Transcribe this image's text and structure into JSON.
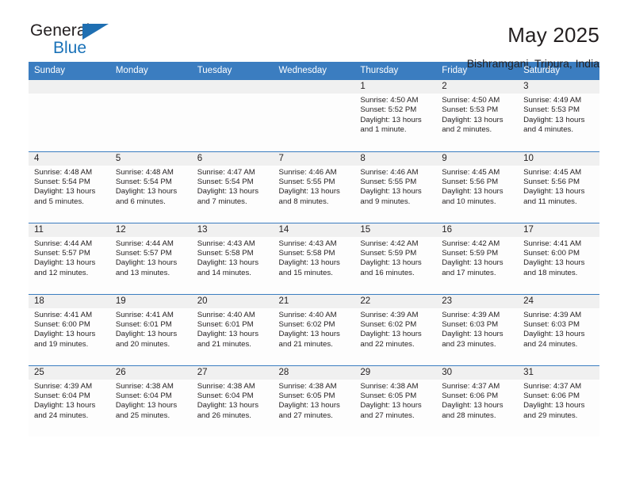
{
  "brand": {
    "name_top": "General",
    "name_bottom": "Blue",
    "accent_color": "#1f6fb2",
    "triangle_icon": "triangle-icon"
  },
  "header": {
    "title": "May 2025",
    "subtitle": "Bishramganj, Tripura, India"
  },
  "calendar": {
    "header_bg": "#3b7dc0",
    "daynum_bg": "#f0f0f0",
    "weekday_headers": [
      "Sunday",
      "Monday",
      "Tuesday",
      "Wednesday",
      "Thursday",
      "Friday",
      "Saturday"
    ],
    "weeks": [
      [
        {
          "day": "",
          "empty": true
        },
        {
          "day": "",
          "empty": true
        },
        {
          "day": "",
          "empty": true
        },
        {
          "day": "",
          "empty": true
        },
        {
          "day": "1",
          "sunrise": "Sunrise: 4:50 AM",
          "sunset": "Sunset: 5:52 PM",
          "daylight1": "Daylight: 13 hours",
          "daylight2": "and 1 minute."
        },
        {
          "day": "2",
          "sunrise": "Sunrise: 4:50 AM",
          "sunset": "Sunset: 5:53 PM",
          "daylight1": "Daylight: 13 hours",
          "daylight2": "and 2 minutes."
        },
        {
          "day": "3",
          "sunrise": "Sunrise: 4:49 AM",
          "sunset": "Sunset: 5:53 PM",
          "daylight1": "Daylight: 13 hours",
          "daylight2": "and 4 minutes."
        }
      ],
      [
        {
          "day": "4",
          "sunrise": "Sunrise: 4:48 AM",
          "sunset": "Sunset: 5:54 PM",
          "daylight1": "Daylight: 13 hours",
          "daylight2": "and 5 minutes."
        },
        {
          "day": "5",
          "sunrise": "Sunrise: 4:48 AM",
          "sunset": "Sunset: 5:54 PM",
          "daylight1": "Daylight: 13 hours",
          "daylight2": "and 6 minutes."
        },
        {
          "day": "6",
          "sunrise": "Sunrise: 4:47 AM",
          "sunset": "Sunset: 5:54 PM",
          "daylight1": "Daylight: 13 hours",
          "daylight2": "and 7 minutes."
        },
        {
          "day": "7",
          "sunrise": "Sunrise: 4:46 AM",
          "sunset": "Sunset: 5:55 PM",
          "daylight1": "Daylight: 13 hours",
          "daylight2": "and 8 minutes."
        },
        {
          "day": "8",
          "sunrise": "Sunrise: 4:46 AM",
          "sunset": "Sunset: 5:55 PM",
          "daylight1": "Daylight: 13 hours",
          "daylight2": "and 9 minutes."
        },
        {
          "day": "9",
          "sunrise": "Sunrise: 4:45 AM",
          "sunset": "Sunset: 5:56 PM",
          "daylight1": "Daylight: 13 hours",
          "daylight2": "and 10 minutes."
        },
        {
          "day": "10",
          "sunrise": "Sunrise: 4:45 AM",
          "sunset": "Sunset: 5:56 PM",
          "daylight1": "Daylight: 13 hours",
          "daylight2": "and 11 minutes."
        }
      ],
      [
        {
          "day": "11",
          "sunrise": "Sunrise: 4:44 AM",
          "sunset": "Sunset: 5:57 PM",
          "daylight1": "Daylight: 13 hours",
          "daylight2": "and 12 minutes."
        },
        {
          "day": "12",
          "sunrise": "Sunrise: 4:44 AM",
          "sunset": "Sunset: 5:57 PM",
          "daylight1": "Daylight: 13 hours",
          "daylight2": "and 13 minutes."
        },
        {
          "day": "13",
          "sunrise": "Sunrise: 4:43 AM",
          "sunset": "Sunset: 5:58 PM",
          "daylight1": "Daylight: 13 hours",
          "daylight2": "and 14 minutes."
        },
        {
          "day": "14",
          "sunrise": "Sunrise: 4:43 AM",
          "sunset": "Sunset: 5:58 PM",
          "daylight1": "Daylight: 13 hours",
          "daylight2": "and 15 minutes."
        },
        {
          "day": "15",
          "sunrise": "Sunrise: 4:42 AM",
          "sunset": "Sunset: 5:59 PM",
          "daylight1": "Daylight: 13 hours",
          "daylight2": "and 16 minutes."
        },
        {
          "day": "16",
          "sunrise": "Sunrise: 4:42 AM",
          "sunset": "Sunset: 5:59 PM",
          "daylight1": "Daylight: 13 hours",
          "daylight2": "and 17 minutes."
        },
        {
          "day": "17",
          "sunrise": "Sunrise: 4:41 AM",
          "sunset": "Sunset: 6:00 PM",
          "daylight1": "Daylight: 13 hours",
          "daylight2": "and 18 minutes."
        }
      ],
      [
        {
          "day": "18",
          "sunrise": "Sunrise: 4:41 AM",
          "sunset": "Sunset: 6:00 PM",
          "daylight1": "Daylight: 13 hours",
          "daylight2": "and 19 minutes."
        },
        {
          "day": "19",
          "sunrise": "Sunrise: 4:41 AM",
          "sunset": "Sunset: 6:01 PM",
          "daylight1": "Daylight: 13 hours",
          "daylight2": "and 20 minutes."
        },
        {
          "day": "20",
          "sunrise": "Sunrise: 4:40 AM",
          "sunset": "Sunset: 6:01 PM",
          "daylight1": "Daylight: 13 hours",
          "daylight2": "and 21 minutes."
        },
        {
          "day": "21",
          "sunrise": "Sunrise: 4:40 AM",
          "sunset": "Sunset: 6:02 PM",
          "daylight1": "Daylight: 13 hours",
          "daylight2": "and 21 minutes."
        },
        {
          "day": "22",
          "sunrise": "Sunrise: 4:39 AM",
          "sunset": "Sunset: 6:02 PM",
          "daylight1": "Daylight: 13 hours",
          "daylight2": "and 22 minutes."
        },
        {
          "day": "23",
          "sunrise": "Sunrise: 4:39 AM",
          "sunset": "Sunset: 6:03 PM",
          "daylight1": "Daylight: 13 hours",
          "daylight2": "and 23 minutes."
        },
        {
          "day": "24",
          "sunrise": "Sunrise: 4:39 AM",
          "sunset": "Sunset: 6:03 PM",
          "daylight1": "Daylight: 13 hours",
          "daylight2": "and 24 minutes."
        }
      ],
      [
        {
          "day": "25",
          "sunrise": "Sunrise: 4:39 AM",
          "sunset": "Sunset: 6:04 PM",
          "daylight1": "Daylight: 13 hours",
          "daylight2": "and 24 minutes."
        },
        {
          "day": "26",
          "sunrise": "Sunrise: 4:38 AM",
          "sunset": "Sunset: 6:04 PM",
          "daylight1": "Daylight: 13 hours",
          "daylight2": "and 25 minutes."
        },
        {
          "day": "27",
          "sunrise": "Sunrise: 4:38 AM",
          "sunset": "Sunset: 6:04 PM",
          "daylight1": "Daylight: 13 hours",
          "daylight2": "and 26 minutes."
        },
        {
          "day": "28",
          "sunrise": "Sunrise: 4:38 AM",
          "sunset": "Sunset: 6:05 PM",
          "daylight1": "Daylight: 13 hours",
          "daylight2": "and 27 minutes."
        },
        {
          "day": "29",
          "sunrise": "Sunrise: 4:38 AM",
          "sunset": "Sunset: 6:05 PM",
          "daylight1": "Daylight: 13 hours",
          "daylight2": "and 27 minutes."
        },
        {
          "day": "30",
          "sunrise": "Sunrise: 4:37 AM",
          "sunset": "Sunset: 6:06 PM",
          "daylight1": "Daylight: 13 hours",
          "daylight2": "and 28 minutes."
        },
        {
          "day": "31",
          "sunrise": "Sunrise: 4:37 AM",
          "sunset": "Sunset: 6:06 PM",
          "daylight1": "Daylight: 13 hours",
          "daylight2": "and 29 minutes."
        }
      ]
    ]
  }
}
